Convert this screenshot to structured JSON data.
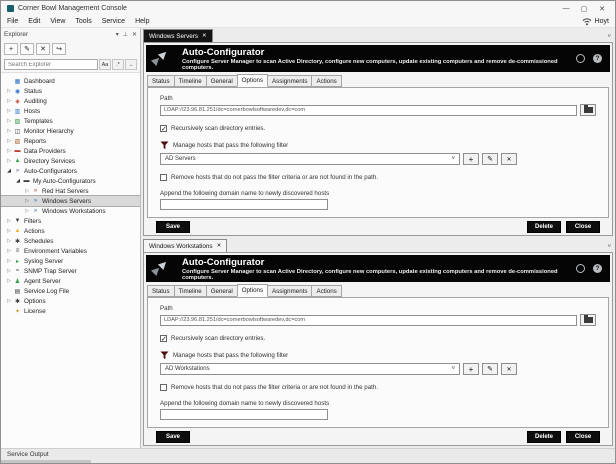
{
  "titlebar": {
    "title": "Corner Bowl Management Console"
  },
  "menubar": {
    "items": [
      "File",
      "Edit",
      "View",
      "Tools",
      "Service",
      "Help"
    ],
    "user": "Hoyt"
  },
  "explorer": {
    "title": "Explorer",
    "search": {
      "placeholder": "Search Explorer",
      "match_case": "Aa",
      "regex": ".*",
      "go": "→"
    },
    "tree": [
      {
        "label": "Dashboard",
        "level": 0,
        "expander": "none",
        "icon": "dashboard",
        "color": "blue",
        "selected": false
      },
      {
        "label": "Status",
        "level": 0,
        "expander": "collapsed",
        "icon": "status",
        "color": "blue",
        "selected": false
      },
      {
        "label": "Auditing",
        "level": 0,
        "expander": "collapsed",
        "icon": "auditing-shield",
        "color": "red",
        "selected": false
      },
      {
        "label": "Hosts",
        "level": 0,
        "expander": "collapsed",
        "icon": "hosts",
        "color": "blue",
        "selected": false
      },
      {
        "label": "Templates",
        "level": 0,
        "expander": "collapsed",
        "icon": "templates",
        "color": "green",
        "selected": false
      },
      {
        "label": "Monitor Hierarchy",
        "level": 0,
        "expander": "collapsed",
        "icon": "monitor-hierarchy",
        "color": "dark",
        "selected": false
      },
      {
        "label": "Reports",
        "level": 0,
        "expander": "collapsed",
        "icon": "reports",
        "color": "brown",
        "selected": false
      },
      {
        "label": "Data Providers",
        "level": 0,
        "expander": "collapsed",
        "icon": "data-providers",
        "color": "red",
        "selected": false
      },
      {
        "label": "Directory Services",
        "level": 0,
        "expander": "collapsed",
        "icon": "directory-services",
        "color": "green",
        "selected": false
      },
      {
        "label": "Auto-Configurators",
        "level": 0,
        "expander": "expanded",
        "icon": "auto-configurator-arrows",
        "color": "purple",
        "selected": false
      },
      {
        "label": "My Auto-Configurators",
        "level": 1,
        "expander": "expanded",
        "icon": "folder",
        "color": "dark",
        "selected": false
      },
      {
        "label": "Red Hat Servers",
        "level": 2,
        "expander": "collapsed",
        "icon": "auto-configurator-arrows",
        "color": "red",
        "selected": false
      },
      {
        "label": "Windows Servers",
        "level": 2,
        "expander": "collapsed",
        "icon": "auto-configurator-arrows",
        "color": "blue",
        "selected": true
      },
      {
        "label": "Windows Workstations",
        "level": 2,
        "expander": "collapsed",
        "icon": "auto-configurator-arrows",
        "color": "blue",
        "selected": false
      },
      {
        "label": "Filters",
        "level": 0,
        "expander": "collapsed",
        "icon": "filter-funnel",
        "color": "dark",
        "selected": false
      },
      {
        "label": "Actions",
        "level": 0,
        "expander": "collapsed",
        "icon": "actions-warning",
        "color": "yellow",
        "selected": false
      },
      {
        "label": "Schedules",
        "level": 0,
        "expander": "collapsed",
        "icon": "schedules-gear",
        "color": "dark",
        "selected": false
      },
      {
        "label": "Environment Variables",
        "level": 0,
        "expander": "collapsed",
        "icon": "environment-variables",
        "color": "dark",
        "selected": false
      },
      {
        "label": "Syslog Server",
        "level": 0,
        "expander": "collapsed",
        "icon": "syslog-server",
        "color": "green",
        "selected": false
      },
      {
        "label": "SNMP Trap Server",
        "level": 0,
        "expander": "collapsed",
        "icon": "snmp-trap-server",
        "color": "dark",
        "selected": false
      },
      {
        "label": "Agent Server",
        "level": 0,
        "expander": "collapsed",
        "icon": "agent-server",
        "color": "green",
        "selected": false
      },
      {
        "label": "Service Log File",
        "level": 0,
        "expander": "none",
        "icon": "service-log-file",
        "color": "dark",
        "selected": false
      },
      {
        "label": "Options",
        "level": 0,
        "expander": "collapsed",
        "icon": "options-gear",
        "color": "dark",
        "selected": false
      },
      {
        "label": "License",
        "level": 0,
        "expander": "none",
        "icon": "license-key",
        "color": "gold",
        "selected": false
      }
    ]
  },
  "panels": [
    {
      "doc_tab": "Windows Servers",
      "header": {
        "title": "Auto-Configurator",
        "subtitle": "Configure Server Manager to scan Active Directory, configure new computers, update existing computers and remove de-commissioned computers."
      },
      "tabs": [
        "Status",
        "Timeline",
        "General",
        "Options",
        "Assignments",
        "Actions"
      ],
      "active_tab": "Options",
      "path": {
        "label": "Path",
        "value": "LDAP://23.96.81.251/dc=cornerbowlsoftwaredev,dc=com"
      },
      "recursive_checkbox": {
        "label": "Recursively scan directory entries.",
        "checked": true
      },
      "filter": {
        "label": "Manage hosts that pass the following filter",
        "value": "AD Servers"
      },
      "remove_checkbox": {
        "label": "Remove hosts that do not pass the filter criteria or are not found in the path.",
        "checked": false
      },
      "append": {
        "label": "Append the following domain name to newly discovered hosts",
        "value": ""
      },
      "buttons": {
        "save": "Save",
        "delete": "Delete",
        "close": "Close"
      }
    },
    {
      "doc_tab": "Windows Workstations",
      "header": {
        "title": "Auto-Configurator",
        "subtitle": "Configure Server Manager to scan Active Directory, configure new computers, update existing computers and remove de-commissioned computers."
      },
      "tabs": [
        "Status",
        "Timeline",
        "General",
        "Options",
        "Assignments",
        "Actions"
      ],
      "active_tab": "Options",
      "path": {
        "label": "Path",
        "value": "LDAP://23.96.81.251/dc=cornerbowlsoftwaredev,dc=com"
      },
      "recursive_checkbox": {
        "label": "Recursively scan directory entries.",
        "checked": true
      },
      "filter": {
        "label": "Manage hosts that pass the following filter",
        "value": "AD Workstations"
      },
      "remove_checkbox": {
        "label": "Remove hosts that do not pass the filter criteria or are not found in the path.",
        "checked": false
      },
      "append": {
        "label": "Append the following domain name to newly discovered hosts",
        "value": ""
      },
      "buttons": {
        "save": "Save",
        "delete": "Delete",
        "close": "Close"
      }
    }
  ],
  "statusbar": {
    "label": "Service Output"
  }
}
